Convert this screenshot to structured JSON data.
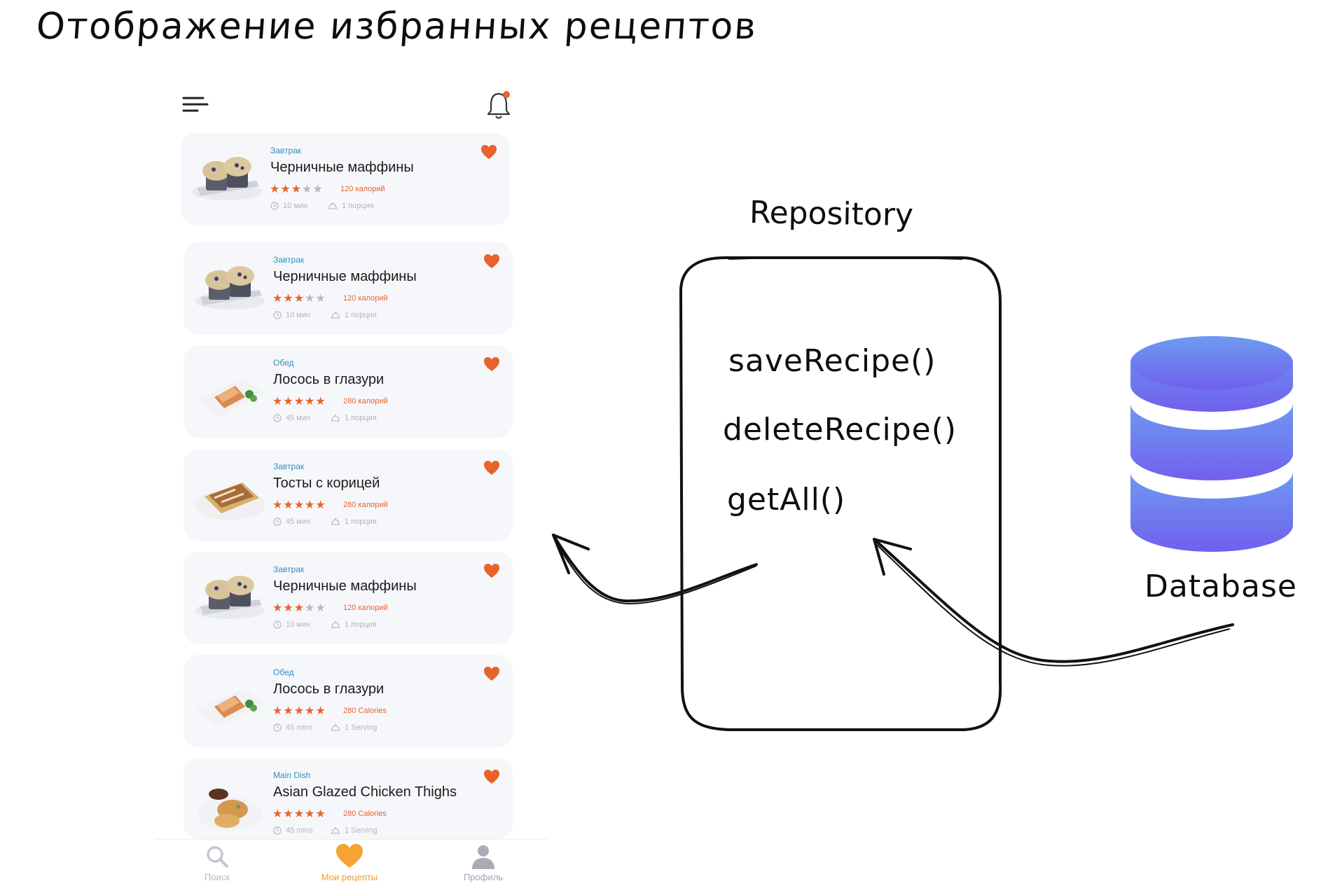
{
  "title": "Отображение избранных рецептов",
  "phone": {
    "cards": [
      {
        "category": "Завтрак",
        "name": "Черничные маффины",
        "rating": 3,
        "calories": "120 калорий",
        "time": "10 мин",
        "servings": "1 порция",
        "image": "muffins"
      },
      {
        "category": "Завтрак",
        "name": "Черничные маффины",
        "rating": 3,
        "calories": "120 калорий",
        "time": "10 мин",
        "servings": "1 порция",
        "image": "muffins"
      },
      {
        "category": "Обед",
        "name": "Лосось в глазури",
        "rating": 5,
        "calories": "280 калорий",
        "time": "45 мин",
        "servings": "1 порция",
        "image": "salmon"
      },
      {
        "category": "Завтрак",
        "name": "Тосты с корицей",
        "rating": 5,
        "calories": "280 калорий",
        "time": "45 мин",
        "servings": "1 порция",
        "image": "toast"
      },
      {
        "category": "Завтрак",
        "name": "Черничные маффины",
        "rating": 3,
        "calories": "120 калорий",
        "time": "10 мин",
        "servings": "1 порция",
        "image": "muffins"
      },
      {
        "category": "Обед",
        "name": "Лосось в глазури",
        "rating": 5,
        "calories": "280 Calories",
        "time": "45 mins",
        "servings": "1 Serving",
        "image": "salmon"
      },
      {
        "category": "Main Dish",
        "name": "Asian Glazed Chicken Thighs",
        "rating": 5,
        "calories": "280 Calories",
        "time": "45 mins",
        "servings": "1 Serving",
        "image": "chicken"
      }
    ],
    "nav": {
      "search": "Поиск",
      "recipes": "Мои рецепты",
      "profile": "Профиль"
    }
  },
  "diagram": {
    "repository_label": "Repository",
    "methods": [
      "saveRecipe()",
      "deleteRecipe()",
      "getAll()"
    ],
    "database_label": "Database"
  },
  "colors": {
    "accent": "#e8622c",
    "nav_active": "#f39a2b",
    "category": "#2f8fc0",
    "db_top": "#6e9bf0",
    "db_bottom": "#7060ee"
  }
}
